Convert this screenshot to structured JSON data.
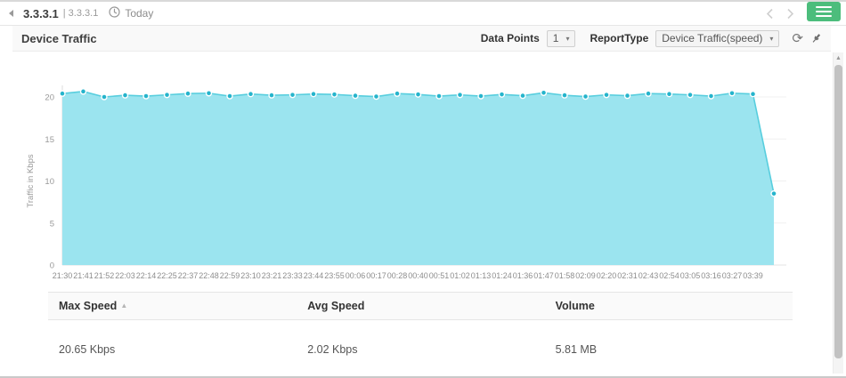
{
  "accent_color": "#4cbd7c",
  "topbar": {
    "device_name": "3.3.3.1",
    "device_subtitle": "| 3.3.3.1",
    "period_label": "Today"
  },
  "toolbar": {
    "title": "Device Traffic",
    "data_points_label": "Data Points",
    "data_points_value": "1",
    "report_type_label": "ReportType",
    "report_type_value": "Device Traffic(speed)"
  },
  "icons": {
    "caret": "▾",
    "refresh": "⟳",
    "sort_asc": "▲",
    "scroll_up": "▲"
  },
  "chart_data": {
    "type": "area",
    "title": "Device Traffic",
    "ylabel": "Traffic in Kbps",
    "ylim": [
      0,
      22
    ],
    "yticks": [
      0,
      5,
      10,
      15,
      20
    ],
    "grid": true,
    "legend": "none",
    "categories": [
      "21:30",
      "21:41",
      "21:52",
      "22:03",
      "22:14",
      "22:25",
      "22:37",
      "22:48",
      "22:59",
      "23:10",
      "23:21",
      "23:33",
      "23:44",
      "23:55",
      "00:06",
      "00:17",
      "00:28",
      "00:40",
      "00:51",
      "01:02",
      "01:13",
      "01:24",
      "01:36",
      "01:47",
      "01:58",
      "02:09",
      "02:20",
      "02:31",
      "02:43",
      "02:54",
      "03:05",
      "03:16",
      "03:27",
      "03:39",
      ""
    ],
    "series": [
      {
        "name": "Traffic in Kbps",
        "values": [
          20.4,
          20.65,
          20.0,
          20.2,
          20.1,
          20.25,
          20.4,
          20.45,
          20.1,
          20.35,
          20.2,
          20.25,
          20.35,
          20.3,
          20.15,
          20.05,
          20.4,
          20.3,
          20.1,
          20.25,
          20.1,
          20.3,
          20.15,
          20.5,
          20.2,
          20.05,
          20.25,
          20.15,
          20.4,
          20.35,
          20.25,
          20.1,
          20.45,
          20.35,
          8.5
        ]
      }
    ],
    "colors": {
      "fill": "#9be4ef",
      "line": "#58cede",
      "dot": "#25b4cc"
    }
  },
  "table": {
    "columns": [
      {
        "label": "Max Speed",
        "sorted": "asc"
      },
      {
        "label": "Avg Speed",
        "sorted": "none"
      },
      {
        "label": "Volume",
        "sorted": "none"
      }
    ],
    "rows": [
      [
        "20.65 Kbps",
        "2.02 Kbps",
        "5.81 MB"
      ]
    ]
  }
}
